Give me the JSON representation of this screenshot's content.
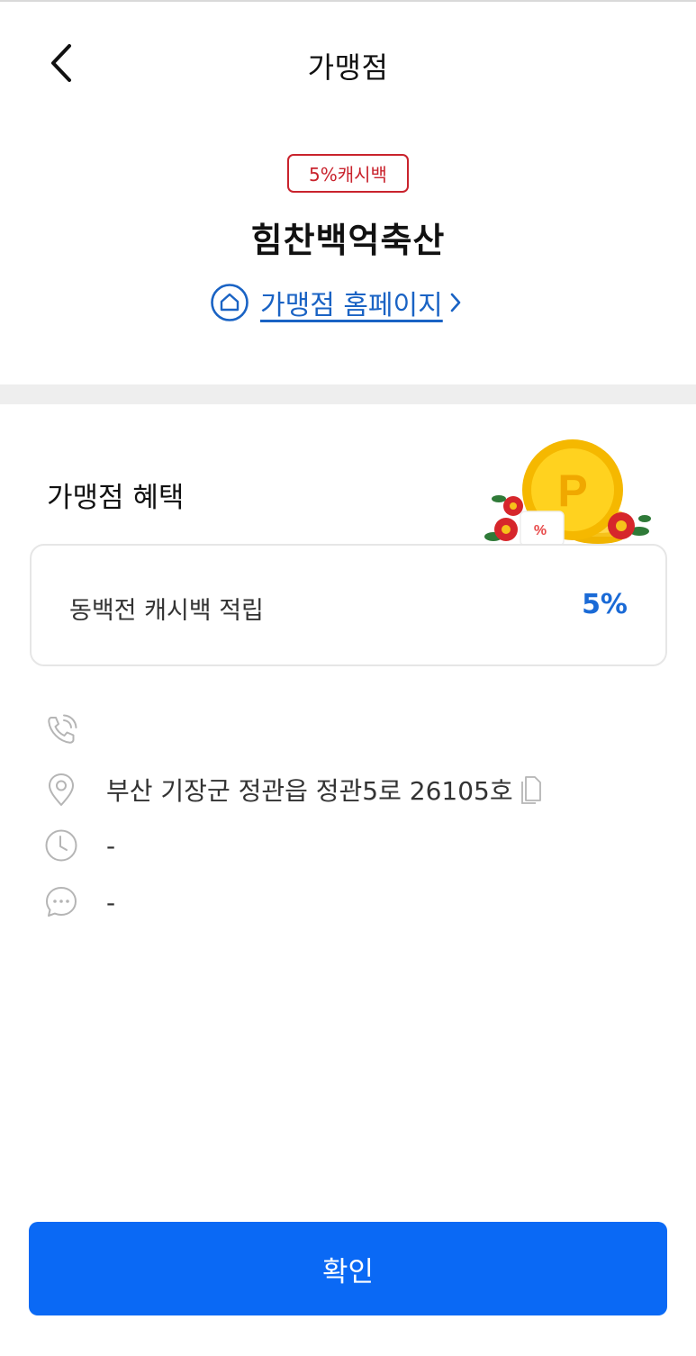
{
  "header": {
    "title": "가맹점",
    "back_icon": "chevron-left-icon"
  },
  "store": {
    "badge": "5%캐시백",
    "name": "힘찬백억축산",
    "homepage_link": "가맹점 홈페이지",
    "badge_color": "#c9232d",
    "link_color": "#1a63c4"
  },
  "benefits": {
    "section_title": "가맹점 혜택",
    "illustration": "gold-coin-p-illustration",
    "items": [
      {
        "label": "동백전 캐시백 적립",
        "value": "5%"
      }
    ],
    "value_color": "#1a6ad6"
  },
  "info": {
    "phone": {
      "icon": "phone-icon",
      "text": ""
    },
    "address": {
      "icon": "location-pin-icon",
      "text": "부산 기장군 정관읍 정관5로 26105호",
      "copy_icon": "copy-icon"
    },
    "hours": {
      "icon": "clock-icon",
      "text": "-"
    },
    "description": {
      "icon": "chat-bubble-icon",
      "text": "-"
    }
  },
  "footer": {
    "confirm_label": "확인",
    "button_color": "#0a69f5"
  }
}
